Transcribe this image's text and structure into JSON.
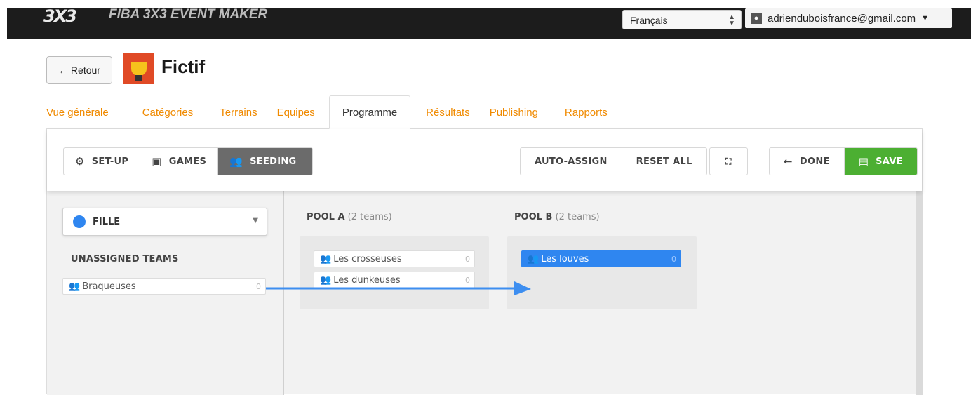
{
  "app": {
    "logo_text": "3X3",
    "title": "FIBA 3X3 EVENT MAKER",
    "language": "Français",
    "user_email": "adrienduboisfrance@gmail.com"
  },
  "header": {
    "back_label": "← Retour",
    "event_name": "Fictif"
  },
  "tabs": [
    {
      "label": "Vue générale"
    },
    {
      "label": "Catégories"
    },
    {
      "label": "Terrains"
    },
    {
      "label": "Equipes"
    },
    {
      "label": "Programme"
    },
    {
      "label": "Résultats"
    },
    {
      "label": "Publishing"
    },
    {
      "label": "Rapports"
    }
  ],
  "active_tab": "Programme",
  "toolbar": {
    "setup_label": "SET-UP",
    "games_label": "GAMES",
    "seeding_label": "SEEDING",
    "auto_assign_label": "AUTO-ASSIGN",
    "reset_all_label": "RESET ALL",
    "done_label": "DONE",
    "save_label": "SAVE"
  },
  "category": {
    "selected": "FILLE",
    "color": "#2f86f0"
  },
  "unassigned": {
    "title": "UNASSIGNED TEAMS",
    "teams": [
      {
        "name": "Braqueuses",
        "count": "0"
      }
    ]
  },
  "pools": [
    {
      "name": "POOL A",
      "sub": "(2 teams)",
      "teams": [
        {
          "name": "Les crosseuses",
          "count": "0"
        },
        {
          "name": "Les dunkeuses",
          "count": "0"
        }
      ]
    },
    {
      "name": "POOL B",
      "sub": "(2 teams)",
      "teams": [
        {
          "name": "Les louves",
          "count": "0"
        }
      ]
    }
  ],
  "colors": {
    "accent": "#2f86f0",
    "tab_link": "#f08a00",
    "save_green": "#4caf32",
    "topbar": "#1c1c1c"
  }
}
